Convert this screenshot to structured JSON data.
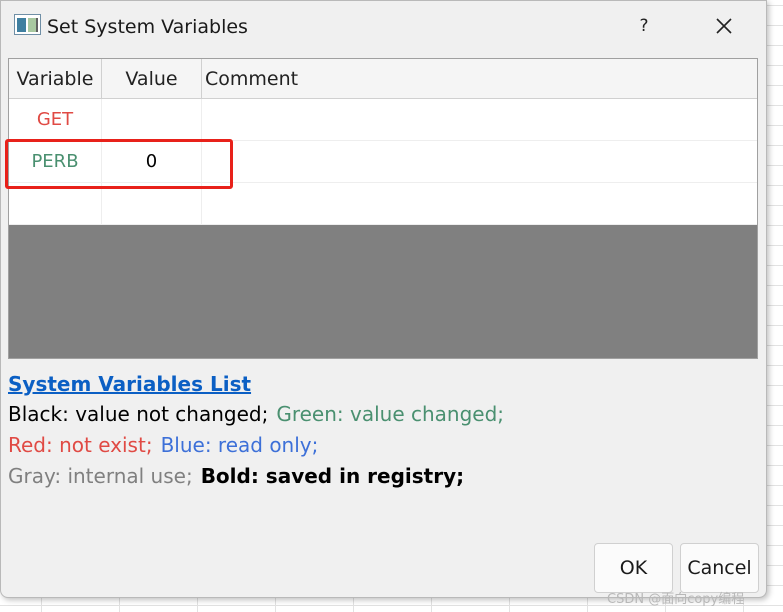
{
  "window": {
    "title": "Set System Variables",
    "help_label": "?",
    "close_icon": "close-icon"
  },
  "table": {
    "columns": [
      "Variable",
      "Value",
      "Comment"
    ],
    "rows": [
      {
        "variable": "GET",
        "value": "",
        "comment": "",
        "color": "#e04a44"
      },
      {
        "variable": "PERB",
        "value": "0",
        "comment": "",
        "color": "#4a9070"
      },
      {
        "variable": "",
        "value": "",
        "comment": ""
      }
    ],
    "highlight_color": "#e8211a"
  },
  "legend": {
    "link": "System Variables List",
    "black": "Black: value not changed;",
    "green": "Green: value changed;",
    "red": "Red: not exist;",
    "blue": "Blue: read only;",
    "gray": "Gray: internal use;",
    "bold": "Bold: saved in registry;"
  },
  "buttons": {
    "ok": "OK",
    "cancel": "Cancel"
  },
  "watermark": "CSDN @面向copy编程",
  "colors": {
    "link": "#0b5fc4",
    "green": "#4a9070",
    "red": "#e04a44",
    "blue": "#3d70d8",
    "gray": "#808080"
  }
}
